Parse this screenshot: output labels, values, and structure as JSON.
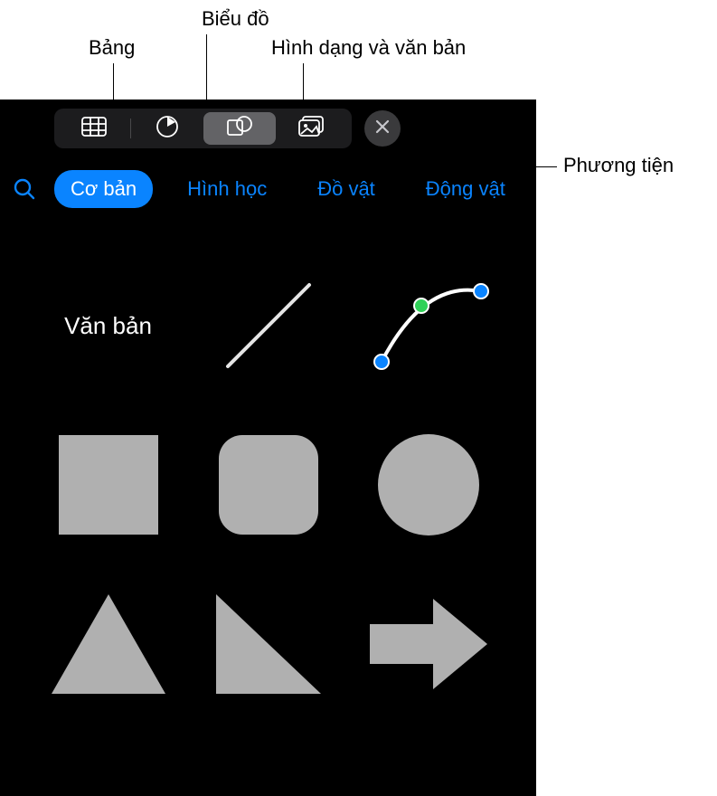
{
  "callouts": {
    "tables": "Bảng",
    "charts": "Biểu đồ",
    "shapes_text": "Hình dạng và văn bản",
    "media": "Phương tiện"
  },
  "toolbar": {
    "icons": {
      "table": "table-icon",
      "chart": "chart-icon",
      "shapes": "shapes-icon",
      "media": "picture-icon",
      "close": "close-icon"
    }
  },
  "tabs": {
    "search": "search",
    "items": [
      "Cơ bản",
      "Hình học",
      "Đồ vật",
      "Động vật"
    ],
    "clipped": "T",
    "active_index": 0
  },
  "shapes": {
    "text_label": "Văn bản",
    "items": [
      "text",
      "line",
      "pen-curve",
      "square",
      "rounded-square",
      "circle",
      "triangle",
      "right-triangle",
      "arrow-right"
    ]
  },
  "colors": {
    "accent": "#0a84ff",
    "shape_fill": "#b0b0b0",
    "seg_selected": "#636366",
    "panel_bg": "#000000"
  }
}
